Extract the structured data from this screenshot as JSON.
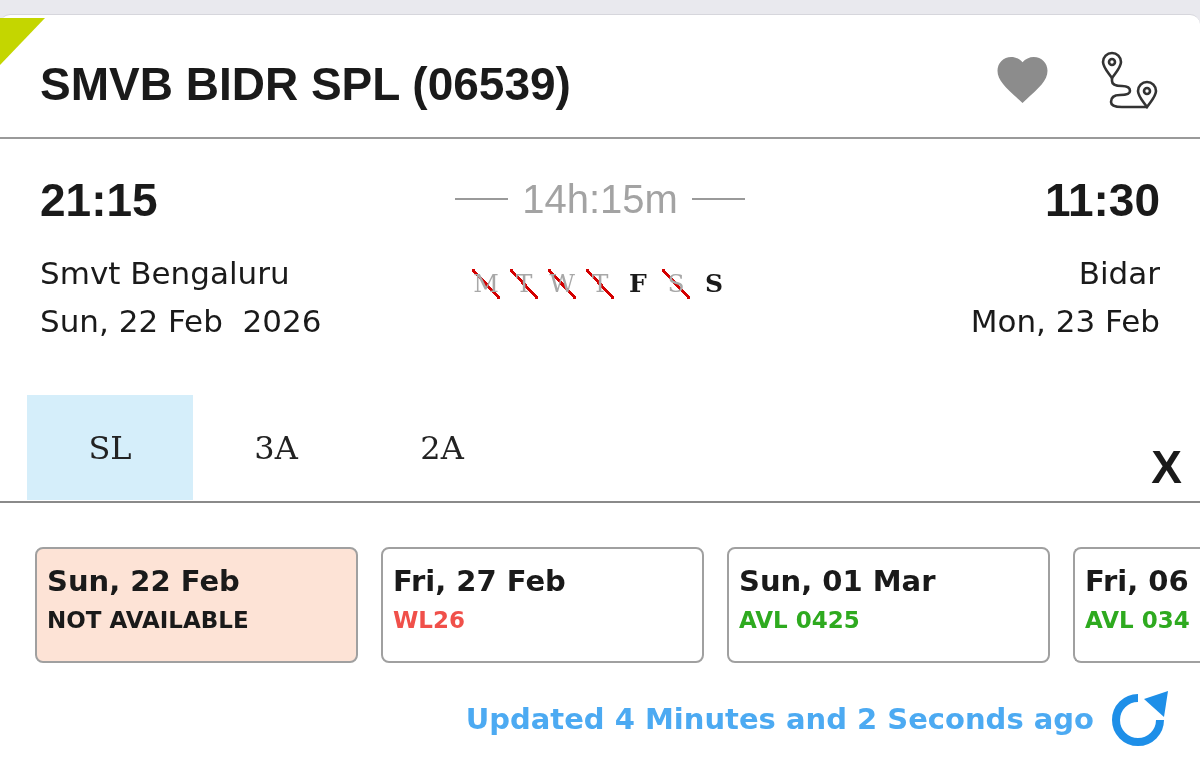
{
  "header": {
    "title": "SMVB BIDR SPL (06539)"
  },
  "journey": {
    "departure": {
      "time": "21:15",
      "station": "Smvt Bengaluru",
      "date": "Sun, 22 Feb  2026"
    },
    "duration": "14h:15m",
    "days": [
      {
        "label": "M",
        "runs": false
      },
      {
        "label": "T",
        "runs": false
      },
      {
        "label": "W",
        "runs": false
      },
      {
        "label": "T",
        "runs": false
      },
      {
        "label": "F",
        "runs": true
      },
      {
        "label": "S",
        "runs": false
      },
      {
        "label": "S",
        "runs": true
      }
    ],
    "arrival": {
      "time": "11:30",
      "station": "Bidar",
      "date": "Mon, 23 Feb"
    }
  },
  "classes": {
    "tabs": [
      {
        "label": "SL",
        "selected": true
      },
      {
        "label": "3A",
        "selected": false
      },
      {
        "label": "2A",
        "selected": false
      }
    ],
    "close": "X"
  },
  "dates": [
    {
      "date": "Sun, 22 Feb",
      "status": "NOT AVAILABLE",
      "kind": "unavailable",
      "selected": true
    },
    {
      "date": "Fri, 27 Feb",
      "status": "WL26",
      "kind": "waitlist",
      "selected": false
    },
    {
      "date": "Sun, 01 Mar",
      "status": "AVL 0425",
      "kind": "available",
      "selected": false
    },
    {
      "date": "Fri, 06",
      "status": "AVL 034",
      "kind": "available",
      "selected": false
    }
  ],
  "updated": "Updated 4 Minutes and 2 Seconds ago"
}
